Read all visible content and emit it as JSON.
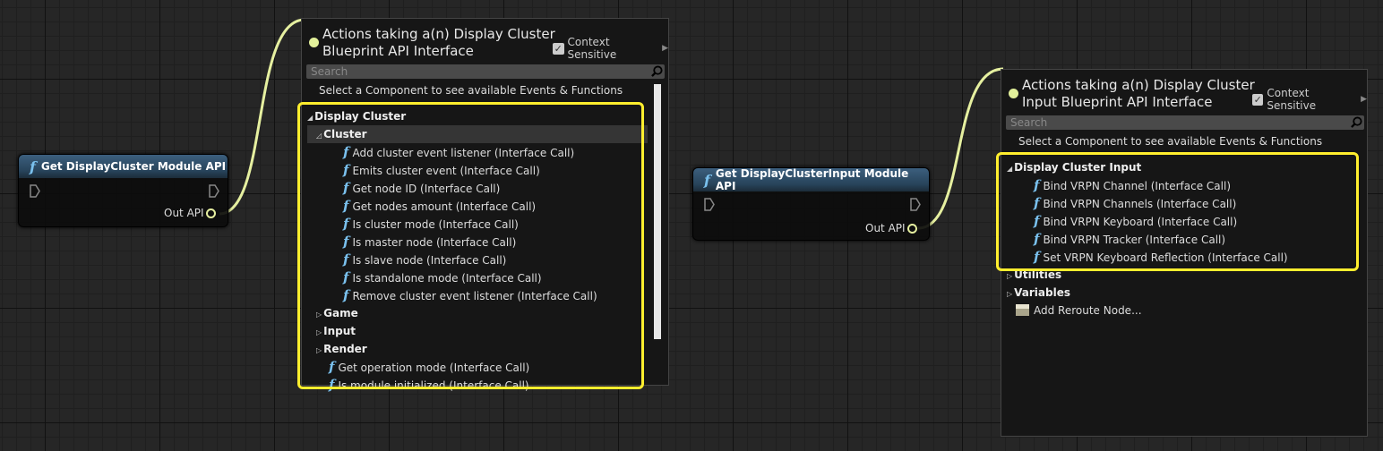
{
  "nodes": [
    {
      "title": "Get DisplayCluster Module API",
      "out_label": "Out API"
    },
    {
      "title": "Get DisplayClusterInput Module API",
      "out_label": "Out API"
    }
  ],
  "menus": [
    {
      "title_line1": "Actions taking a(n) Display Cluster",
      "title_line2": "Blueprint API Interface",
      "context_label": "Context Sensitive",
      "search_placeholder": "Search",
      "hint": "Select a Component to see available Events & Functions",
      "rows": [
        {
          "type": "cat",
          "indent": 0,
          "arrow": "◢",
          "label": "Display Cluster"
        },
        {
          "type": "cat",
          "indent": 1,
          "arrow": "◿",
          "label": "Cluster",
          "selected": true
        },
        {
          "type": "fn",
          "indent": 2,
          "label": "Add cluster event listener (Interface Call)"
        },
        {
          "type": "fn",
          "indent": 2,
          "label": "Emits cluster event (Interface Call)"
        },
        {
          "type": "fn",
          "indent": 2,
          "label": "Get node ID (Interface Call)"
        },
        {
          "type": "fn",
          "indent": 2,
          "label": "Get nodes amount (Interface Call)"
        },
        {
          "type": "fn",
          "indent": 2,
          "label": "Is cluster mode (Interface Call)"
        },
        {
          "type": "fn",
          "indent": 2,
          "label": "Is master node (Interface Call)"
        },
        {
          "type": "fn",
          "indent": 2,
          "label": "Is slave node (Interface Call)"
        },
        {
          "type": "fn",
          "indent": 2,
          "label": "Is standalone mode (Interface Call)"
        },
        {
          "type": "fn",
          "indent": 2,
          "label": "Remove cluster event listener (Interface Call)"
        },
        {
          "type": "cat",
          "indent": 1,
          "arrow": "▷",
          "label": "Game"
        },
        {
          "type": "cat",
          "indent": 1,
          "arrow": "▷",
          "label": "Input"
        },
        {
          "type": "cat",
          "indent": 1,
          "arrow": "▷",
          "label": "Render"
        },
        {
          "type": "fn",
          "indent": 1,
          "label": "Get operation mode (Interface Call)"
        },
        {
          "type": "fn",
          "indent": 1,
          "label": "Is module initialized (Interface Call)"
        }
      ]
    },
    {
      "title_line1": "Actions taking a(n) Display Cluster",
      "title_line2": "Input Blueprint API Interface",
      "context_label": "Context Sensitive",
      "search_placeholder": "Search",
      "hint": "Select a Component to see available Events & Functions",
      "rows": [
        {
          "type": "cat",
          "indent": 0,
          "arrow": "◢",
          "label": "Display Cluster Input"
        },
        {
          "type": "fn",
          "indent": 1,
          "label": "Bind VRPN Channel (Interface Call)"
        },
        {
          "type": "fn",
          "indent": 1,
          "label": "Bind VRPN Channels (Interface Call)"
        },
        {
          "type": "fn",
          "indent": 1,
          "label": "Bind VRPN Keyboard (Interface Call)"
        },
        {
          "type": "fn",
          "indent": 1,
          "label": "Bind VRPN Tracker (Interface Call)"
        },
        {
          "type": "fn",
          "indent": 1,
          "label": "Set VRPN Keyboard Reflection (Interface Call)"
        },
        {
          "type": "cat",
          "indent": 0,
          "arrow": "▷",
          "label": "Utilities"
        },
        {
          "type": "cat",
          "indent": 0,
          "arrow": "▷",
          "label": "Variables"
        },
        {
          "type": "reroute",
          "indent": 0,
          "label": "Add Reroute Node..."
        }
      ]
    }
  ],
  "colors": {
    "highlight": "#ffee2e",
    "wire": "#e6f0a0",
    "function_icon": "#7ac1ee"
  }
}
